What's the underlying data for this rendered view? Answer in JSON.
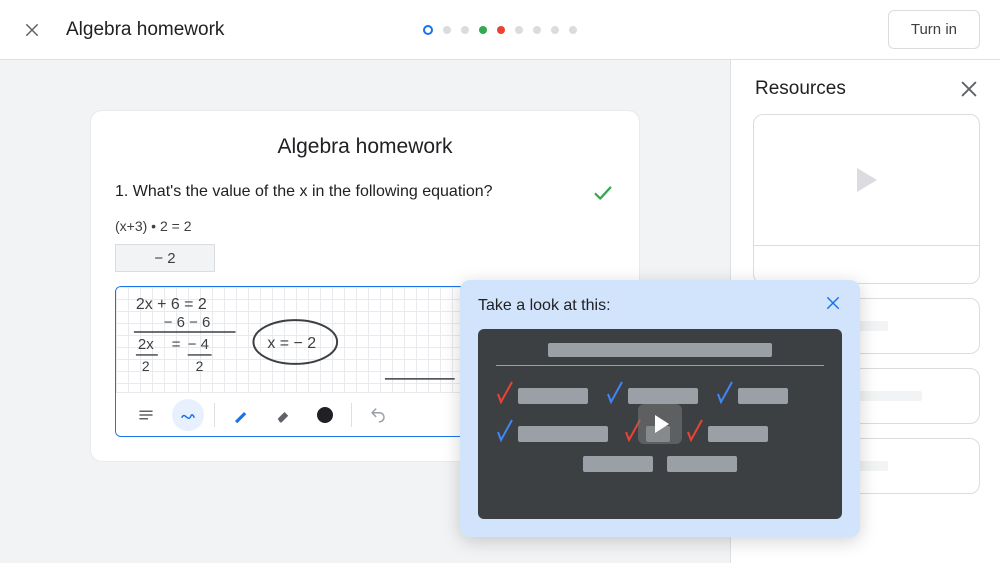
{
  "header": {
    "title": "Algebra homework",
    "turn_in": "Turn in"
  },
  "resources": {
    "title": "Resources"
  },
  "card": {
    "title": "Algebra homework",
    "q1_label": "1. What's the value of the x in the following equation?",
    "q1_equation": "(x+3) • 2 = 2",
    "q1_answer": "− 2"
  },
  "handwriting": {
    "line1": "2x + 6 = 2",
    "line2": "− 6  − 6",
    "line3_left": "2x",
    "line3_right": "− 4",
    "line3_left_den": "2",
    "line3_right_den": "2",
    "circled": "x = − 2"
  },
  "popup": {
    "title": "Take a look at this:"
  }
}
